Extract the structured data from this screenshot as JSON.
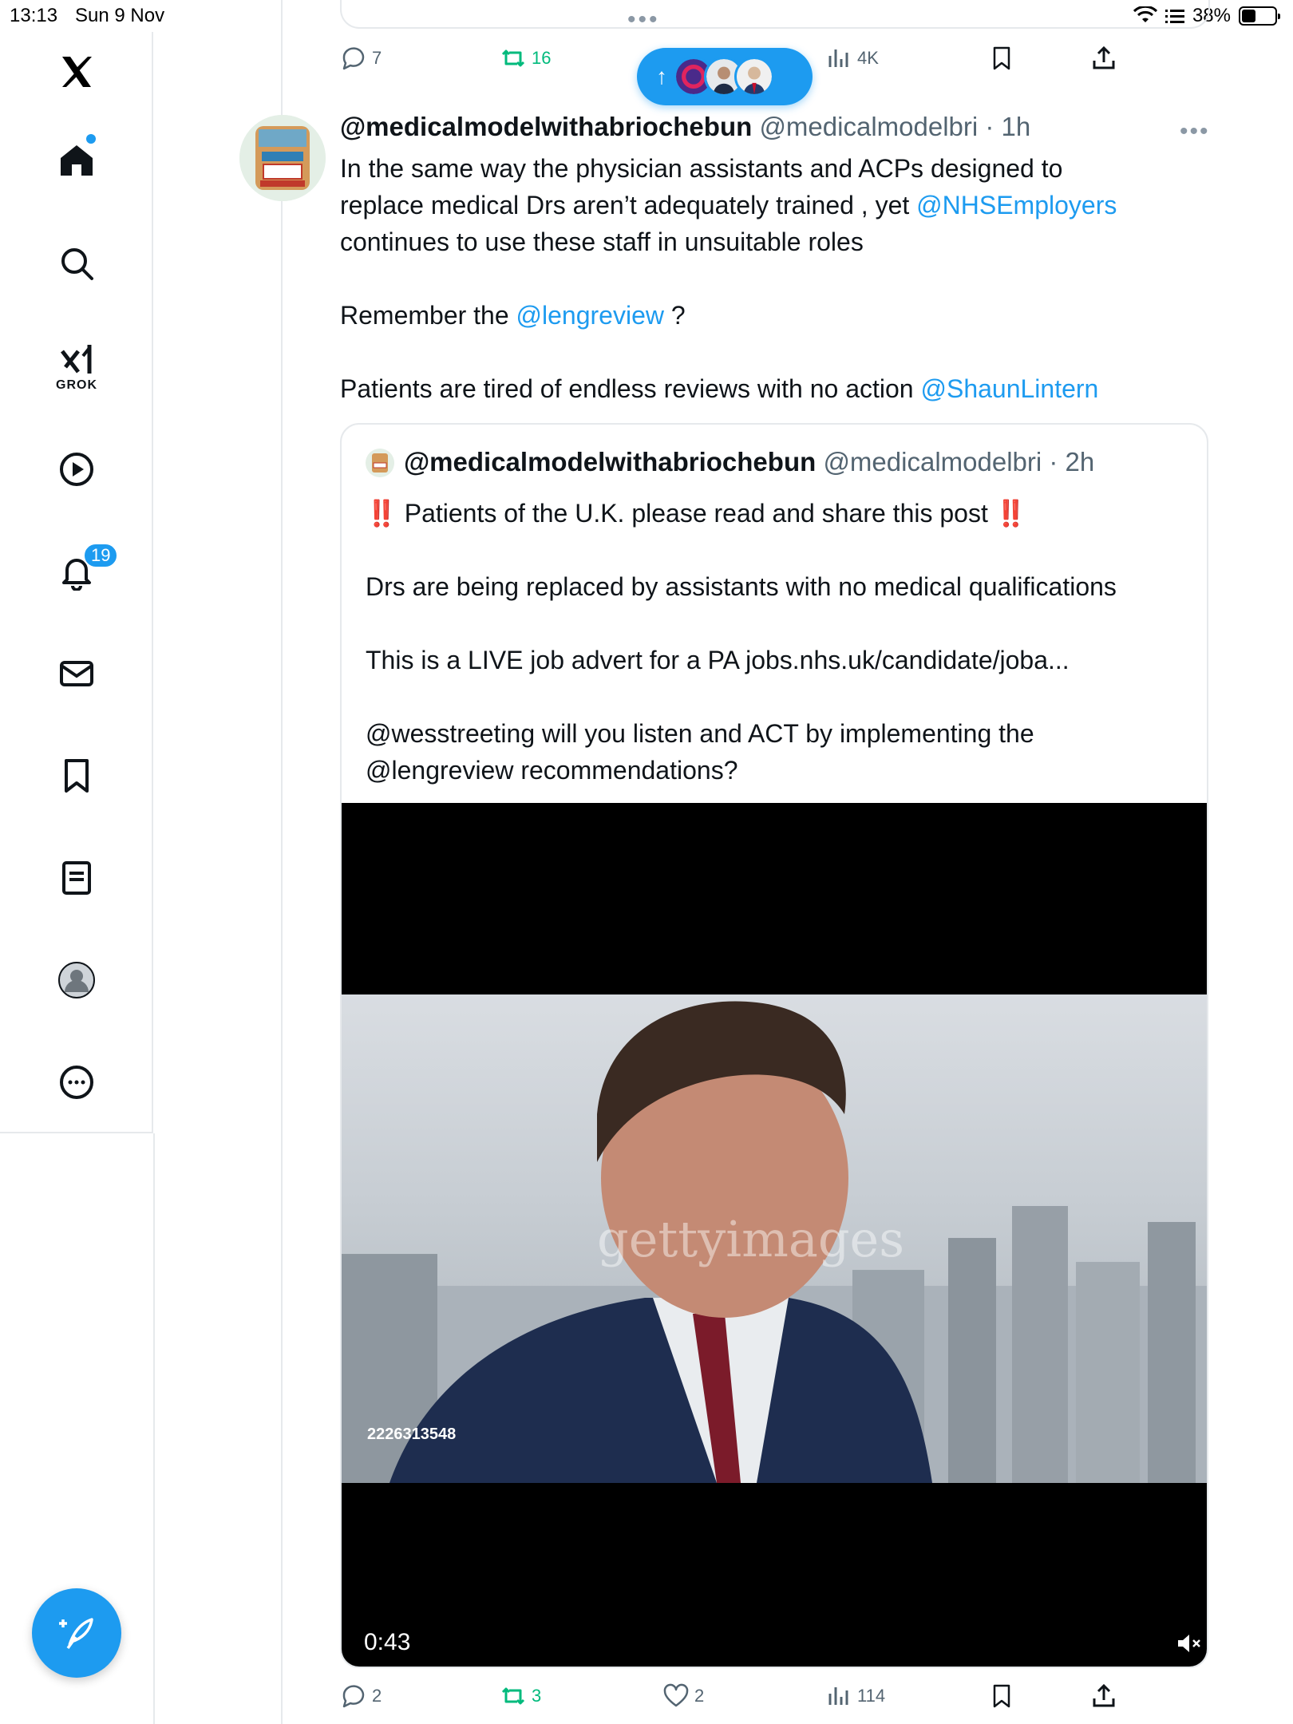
{
  "status_bar": {
    "time": "13:13",
    "date": "Sun 9 Nov",
    "battery": "38%",
    "battery_level": 0.38
  },
  "nav": {
    "grok_label": "GROK",
    "notifications_count": "19"
  },
  "previous_tweet": {
    "replies": "7",
    "retweets": "16",
    "views": "4K"
  },
  "tweet": {
    "name": "@medicalmodelwithabriochebun",
    "handle": "@medicalmodelbri",
    "time": "· 1h",
    "line1": "In the same way the physician assistants and ACPs  designed to",
    "line2_pre": "replace medical Drs aren’t adequately trained , yet ",
    "line2_mention": "@NHSEmployers",
    "line3": "continues to use these staff in unsuitable roles",
    "line4_pre": "Remember the ",
    "line4_mention": "@lengreview",
    "line4_post": " ?",
    "line5_pre": "Patients are tired of endless reviews with no action ",
    "line5_mention": "@ShaunLintern",
    "replies": "2",
    "retweets": "3",
    "likes": "2",
    "views": "114"
  },
  "quote": {
    "name": "@medicalmodelwithabriochebun",
    "handle": "@medicalmodelbri",
    "time": "· 2h",
    "bang": "‼️",
    "line1": " Patients of the U.K. please read and share this post ",
    "line2": "Drs are being replaced by assistants with no medical qualifications",
    "line3": "This is a LIVE job advert for a PA  jobs.nhs.uk/candidate/joba...",
    "line4": "@wesstreeting will you listen and ACT by implementing the",
    "line5": "@lengreview recommendations?",
    "video": {
      "duration": "0:43",
      "image_id": "2226313548",
      "watermark": "gettyimages"
    }
  },
  "colors": {
    "accent": "#1d9bf0",
    "retweet": "#00ba7c",
    "muted": "#536471",
    "border": "#e6e9ec"
  }
}
